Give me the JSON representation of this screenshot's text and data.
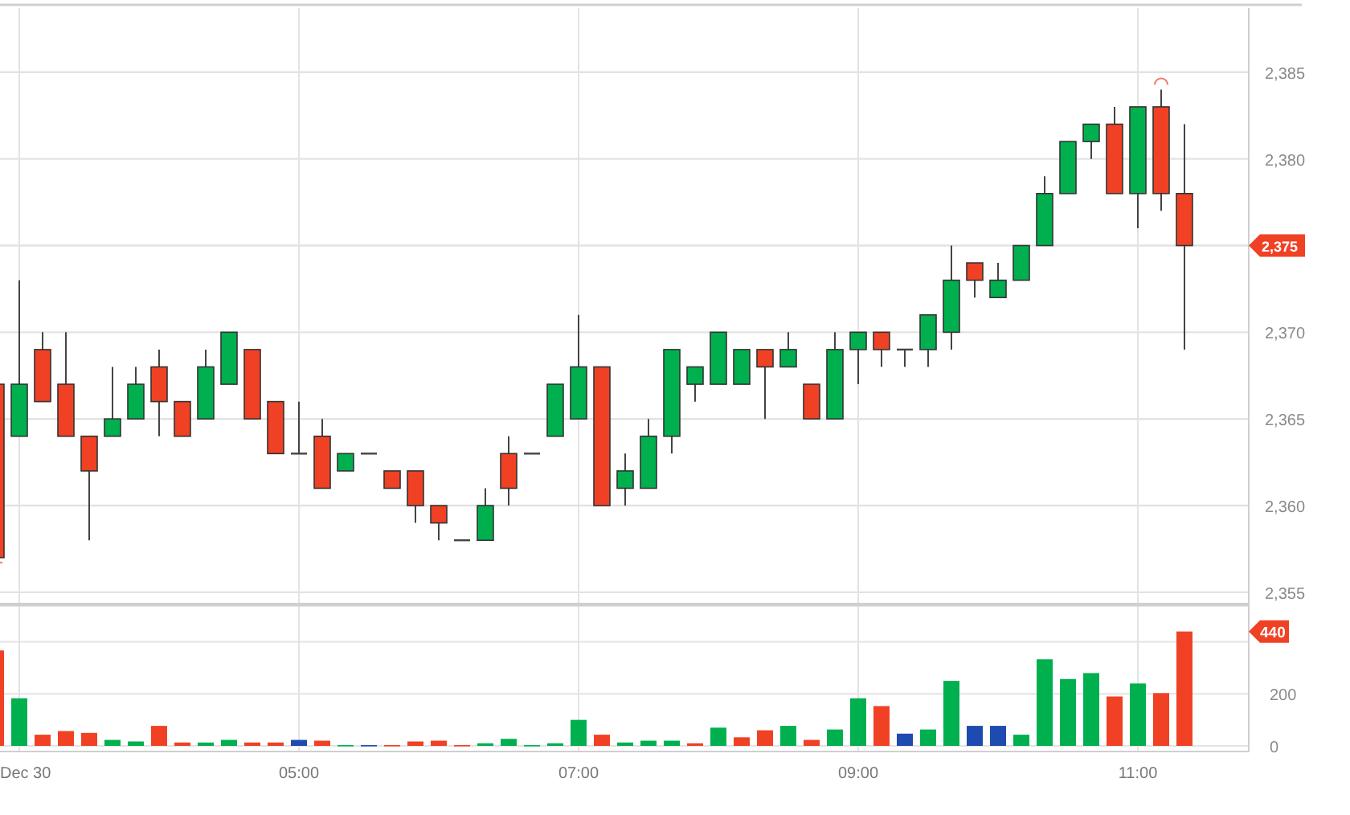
{
  "price_chart": {
    "chart_data": {
      "type": "candlestick",
      "grid": true,
      "categories": [
        null,
        null,
        null,
        null,
        null,
        null,
        null,
        null,
        null,
        null,
        null,
        null,
        null,
        null,
        null,
        null,
        null,
        null,
        null,
        null,
        null,
        null,
        null,
        null,
        null,
        null,
        null,
        null,
        null,
        null,
        null,
        null,
        null,
        null,
        null,
        null,
        null,
        null,
        null,
        null,
        null,
        null,
        null,
        null,
        null,
        null,
        null,
        null,
        null,
        null,
        null,
        null
      ],
      "ohlc": [
        [
          2367,
          2367,
          2357,
          2357
        ],
        [
          2364,
          2373,
          2364,
          2367
        ],
        [
          2369,
          2370,
          2366,
          2366
        ],
        [
          2367,
          2370,
          2364,
          2364
        ],
        [
          2364,
          2364,
          2358,
          2362
        ],
        [
          2364,
          2368,
          2364,
          2365
        ],
        [
          2365,
          2368,
          2365,
          2367
        ],
        [
          2368,
          2369,
          2364,
          2366
        ],
        [
          2366,
          2366,
          2364,
          2364
        ],
        [
          2365,
          2369,
          2365,
          2368
        ],
        [
          2367,
          2370,
          2367,
          2370
        ],
        [
          2369,
          2369,
          2365,
          2365
        ],
        [
          2366,
          2366,
          2363,
          2363
        ],
        [
          2363,
          2366,
          2363,
          2363
        ],
        [
          2364,
          2365,
          2361,
          2361
        ],
        [
          2362,
          2363,
          2362,
          2363
        ],
        [
          2363,
          2363,
          2363,
          2363
        ],
        [
          2362,
          2362,
          2361,
          2361
        ],
        [
          2362,
          2362,
          2359,
          2360
        ],
        [
          2360,
          2360,
          2358,
          2359
        ],
        [
          2358,
          2358,
          2358,
          2358
        ],
        [
          2358,
          2361,
          2358,
          2360
        ],
        [
          2363,
          2364,
          2360,
          2361
        ],
        [
          2363,
          2363,
          2363,
          2363
        ],
        [
          2364,
          2367,
          2364,
          2367
        ],
        [
          2365,
          2371,
          2365,
          2368
        ],
        [
          2368,
          2368,
          2360,
          2360
        ],
        [
          2361,
          2363,
          2360,
          2362
        ],
        [
          2361,
          2365,
          2361,
          2364
        ],
        [
          2364,
          2369,
          2363,
          2369
        ],
        [
          2367,
          2368,
          2366,
          2368
        ],
        [
          2367,
          2370,
          2367,
          2370
        ],
        [
          2367,
          2369,
          2367,
          2369
        ],
        [
          2369,
          2369,
          2365,
          2368
        ],
        [
          2368,
          2370,
          2368,
          2369
        ],
        [
          2367,
          2367,
          2365,
          2365
        ],
        [
          2365,
          2370,
          2365,
          2369
        ],
        [
          2369,
          2370,
          2367,
          2370
        ],
        [
          2370,
          2370,
          2368,
          2369
        ],
        [
          2369,
          2369,
          2368,
          2369
        ],
        [
          2369,
          2371,
          2368,
          2371
        ],
        [
          2370,
          2375,
          2369,
          2373
        ],
        [
          2374,
          2374,
          2372,
          2373
        ],
        [
          2372,
          2374,
          2372,
          2373
        ],
        [
          2373,
          2375,
          2373,
          2375
        ],
        [
          2375,
          2379,
          2375,
          2378
        ],
        [
          2378,
          2381,
          2378,
          2381
        ],
        [
          2381,
          2382,
          2380,
          2382
        ],
        [
          2382,
          2383,
          2378,
          2378
        ],
        [
          2378,
          2383,
          2376,
          2383
        ],
        [
          2383,
          2384,
          2377,
          2378
        ],
        [
          2378,
          2382,
          2369,
          2375
        ]
      ],
      "ylim": [
        2354.3,
        2388.7
      ],
      "yticks": [
        {
          "value": 2355,
          "label": "2,355"
        },
        {
          "value": 2360,
          "label": "2,360"
        },
        {
          "value": 2365,
          "label": "2,365"
        },
        {
          "value": 2370,
          "label": "2,370"
        },
        {
          "value": 2380,
          "label": "2,380"
        },
        {
          "value": 2385,
          "label": "2,385"
        }
      ]
    },
    "last_price_label": "2,375"
  },
  "volume_chart": {
    "chart_data": {
      "type": "bar",
      "grid": true,
      "categories": [
        null,
        "Dec 30",
        null,
        null,
        null,
        null,
        null,
        null,
        null,
        null,
        null,
        null,
        null,
        "05:00",
        null,
        null,
        null,
        null,
        null,
        null,
        null,
        null,
        null,
        null,
        null,
        "07:00",
        null,
        null,
        null,
        null,
        null,
        null,
        null,
        null,
        null,
        null,
        null,
        "09:00",
        null,
        null,
        null,
        null,
        null,
        null,
        null,
        null,
        null,
        null,
        null,
        "11:00",
        null,
        null
      ],
      "values": [
        367,
        183,
        43,
        57,
        50,
        23,
        17,
        77,
        13,
        13,
        23,
        13,
        13,
        23,
        20,
        3,
        3,
        3,
        17,
        20,
        3,
        10,
        27,
        3,
        10,
        100,
        43,
        13,
        20,
        20,
        10,
        70,
        33,
        60,
        77,
        23,
        63,
        183,
        153,
        47,
        63,
        250,
        77,
        77,
        43,
        333,
        257,
        280,
        190,
        240,
        203,
        440
      ],
      "ylim": [
        0,
        544
      ],
      "yticks": [
        0,
        200
      ]
    },
    "bars": [
      {
        "color": "#f04124"
      },
      {
        "color": "#00b04f"
      },
      {
        "color": "#f04124"
      },
      {
        "color": "#f04124"
      },
      {
        "color": "#f04124"
      },
      {
        "color": "#00b04f"
      },
      {
        "color": "#00b04f"
      },
      {
        "color": "#f04124"
      },
      {
        "color": "#f04124"
      },
      {
        "color": "#00b04f"
      },
      {
        "color": "#00b04f"
      },
      {
        "color": "#f04124"
      },
      {
        "color": "#f04124"
      },
      {
        "color": "#1e4bb0"
      },
      {
        "color": "#f04124"
      },
      {
        "color": "#00b04f"
      },
      {
        "color": "#1e4bb0"
      },
      {
        "color": "#f04124"
      },
      {
        "color": "#f04124"
      },
      {
        "color": "#f04124"
      },
      {
        "color": "#f04124"
      },
      {
        "color": "#00b04f"
      },
      {
        "color": "#00b04f"
      },
      {
        "color": "#00b04f"
      },
      {
        "color": "#00b04f"
      },
      {
        "color": "#00b04f"
      },
      {
        "color": "#f04124"
      },
      {
        "color": "#00b04f"
      },
      {
        "color": "#00b04f"
      },
      {
        "color": "#00b04f"
      },
      {
        "color": "#f04124"
      },
      {
        "color": "#00b04f"
      },
      {
        "color": "#f04124"
      },
      {
        "color": "#f04124"
      },
      {
        "color": "#00b04f"
      },
      {
        "color": "#f04124"
      },
      {
        "color": "#00b04f"
      },
      {
        "color": "#00b04f"
      },
      {
        "color": "#f04124"
      },
      {
        "color": "#1e4bb0"
      },
      {
        "color": "#00b04f"
      },
      {
        "color": "#00b04f"
      },
      {
        "color": "#1e4bb0"
      },
      {
        "color": "#1e4bb0"
      },
      {
        "color": "#00b04f"
      },
      {
        "color": "#00b04f"
      },
      {
        "color": "#00b04f"
      },
      {
        "color": "#00b04f"
      },
      {
        "color": "#f04124"
      },
      {
        "color": "#00b04f"
      },
      {
        "color": "#f04124"
      },
      {
        "color": "#f04124"
      }
    ],
    "last_volume_label": "440"
  }
}
